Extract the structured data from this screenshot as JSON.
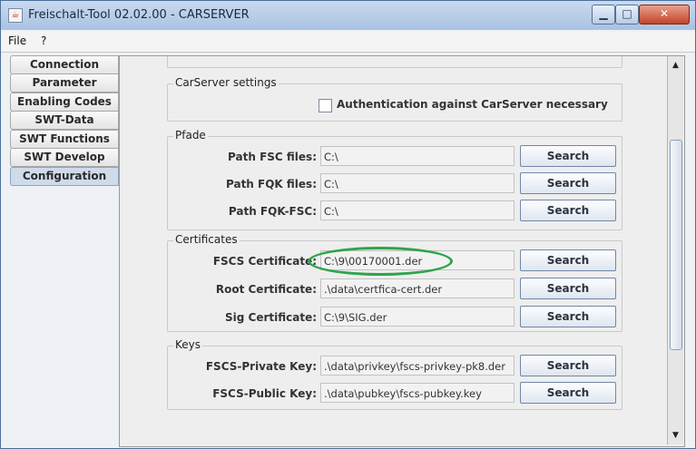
{
  "window": {
    "title": "Freischalt-Tool 02.02.00 - CARSERVER"
  },
  "menu": [
    "File",
    "?"
  ],
  "tabs": [
    "Connection",
    "Parameter",
    "Enabling Codes",
    "SWT-Data",
    "SWT Functions",
    "SWT Develop",
    "Configuration"
  ],
  "active_tab": "Configuration",
  "carserver": {
    "title": "CarServer settings",
    "auth_checkbox_label": "Authentication against CarServer necessary",
    "auth_checked": false
  },
  "pfade": {
    "title": "Pfade",
    "rows": [
      {
        "label": "Path FSC files:",
        "value": "C:\\",
        "button": "Search"
      },
      {
        "label": "Path FQK files:",
        "value": "C:\\",
        "button": "Search"
      },
      {
        "label": "Path FQK-FSC:",
        "value": "C:\\",
        "button": "Search"
      }
    ]
  },
  "certificates": {
    "title": "Certificates",
    "rows": [
      {
        "label": "FSCS Certificate:",
        "value": "C:\\9\\00170001.der",
        "button": "Search"
      },
      {
        "label": "Root Certificate:",
        "value": ".\\data\\certfica-cert.der",
        "button": "Search"
      },
      {
        "label": "Sig Certificate:",
        "value": "C:\\9\\SIG.der",
        "button": "Search"
      }
    ]
  },
  "keys": {
    "title": "Keys",
    "rows": [
      {
        "label": "FSCS-Private Key:",
        "value": ".\\data\\privkey\\fscs-privkey-pk8.der",
        "button": "Search"
      },
      {
        "label": "FSCS-Public Key:",
        "value": ".\\data\\pubkey\\fscs-pubkey.key",
        "button": "Search"
      }
    ]
  }
}
